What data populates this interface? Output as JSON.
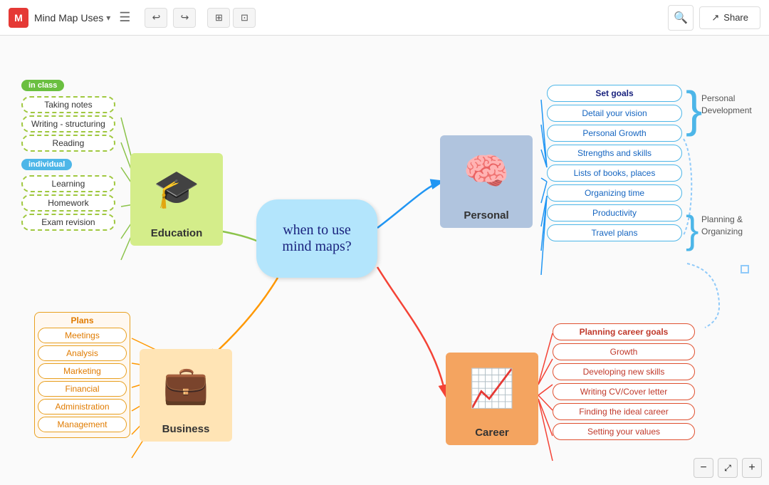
{
  "toolbar": {
    "logo": "M",
    "title": "Mind Map Uses",
    "undo": "↩",
    "redo": "↪",
    "view1": "⊞",
    "view2": "⊡",
    "search_icon": "🔍",
    "share_icon": "↗",
    "share_label": "Share"
  },
  "center": {
    "text": "when to use\nmind maps?"
  },
  "education": {
    "label": "Education",
    "in_class_tag": "in class",
    "items_in_class": [
      "Taking notes",
      "Writing - structuring",
      "Reading"
    ],
    "individual_tag": "individual",
    "items_individual": [
      "Learning",
      "Homework",
      "Exam revision"
    ]
  },
  "personal": {
    "label": "Personal",
    "items": [
      "Set goals",
      "Detail your vision",
      "Personal Growth",
      "Strengths and skills",
      "Lists of books, places",
      "Organizing time",
      "Productivity",
      "Travel plans"
    ],
    "personal_development_label": "Personal\nDevelopment",
    "planning_label": "Planning &\nOrganizing"
  },
  "business": {
    "label": "Business",
    "plans_tag": "Plans",
    "items": [
      "Meetings",
      "Analysis",
      "Marketing",
      "Financial",
      "Administration",
      "Management"
    ]
  },
  "career": {
    "label": "Career",
    "items": [
      "Planning career goals",
      "Growth",
      "Developing new skills",
      "Writing CV/Cover letter",
      "Finding the ideal career",
      "Setting  your values"
    ]
  },
  "zoom": {
    "minus": "−",
    "plus": "+",
    "fit": "⤢"
  }
}
